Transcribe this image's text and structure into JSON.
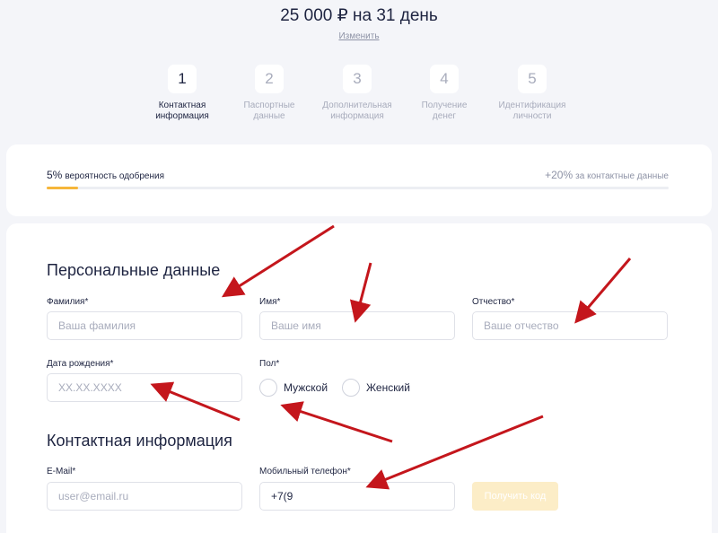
{
  "header": {
    "title": "25 000 ₽ на 31 день",
    "change_link": "Изменить"
  },
  "steps": [
    {
      "num": "1",
      "label": "Контактная\nинформация",
      "active": true
    },
    {
      "num": "2",
      "label": "Паспортные\nданные",
      "active": false
    },
    {
      "num": "3",
      "label": "Дополнительная\nинформация",
      "active": false
    },
    {
      "num": "4",
      "label": "Получение\nденег",
      "active": false
    },
    {
      "num": "5",
      "label": "Идентификация\nличности",
      "active": false
    }
  ],
  "progress": {
    "left_pct": "5%",
    "left_text": "вероятность одобрения",
    "right_pct": "+20%",
    "right_text": "за контактные данные",
    "value": 0.05
  },
  "personal": {
    "title": "Персональные данные",
    "lastname_label": "Фамилия*",
    "lastname_placeholder": "Ваша фамилия",
    "firstname_label": "Имя*",
    "firstname_placeholder": "Ваше имя",
    "patronymic_label": "Отчество*",
    "patronymic_placeholder": "Ваше отчество",
    "birthdate_label": "Дата рождения*",
    "birthdate_placeholder": "XX.XX.XXXX",
    "gender_label": "Пол*",
    "gender_male": "Мужской",
    "gender_female": "Женский"
  },
  "contact": {
    "title": "Контактная информация",
    "email_label": "E-Mail*",
    "email_placeholder": "user@email.ru",
    "phone_label": "Мобильный телефон*",
    "phone_value": "+7(9",
    "get_code_button": "Получить код"
  },
  "colors": {
    "accent": "#f6b63a",
    "arrow": "#c4161c",
    "text": "#1e2441",
    "muted": "#a8acbc"
  }
}
